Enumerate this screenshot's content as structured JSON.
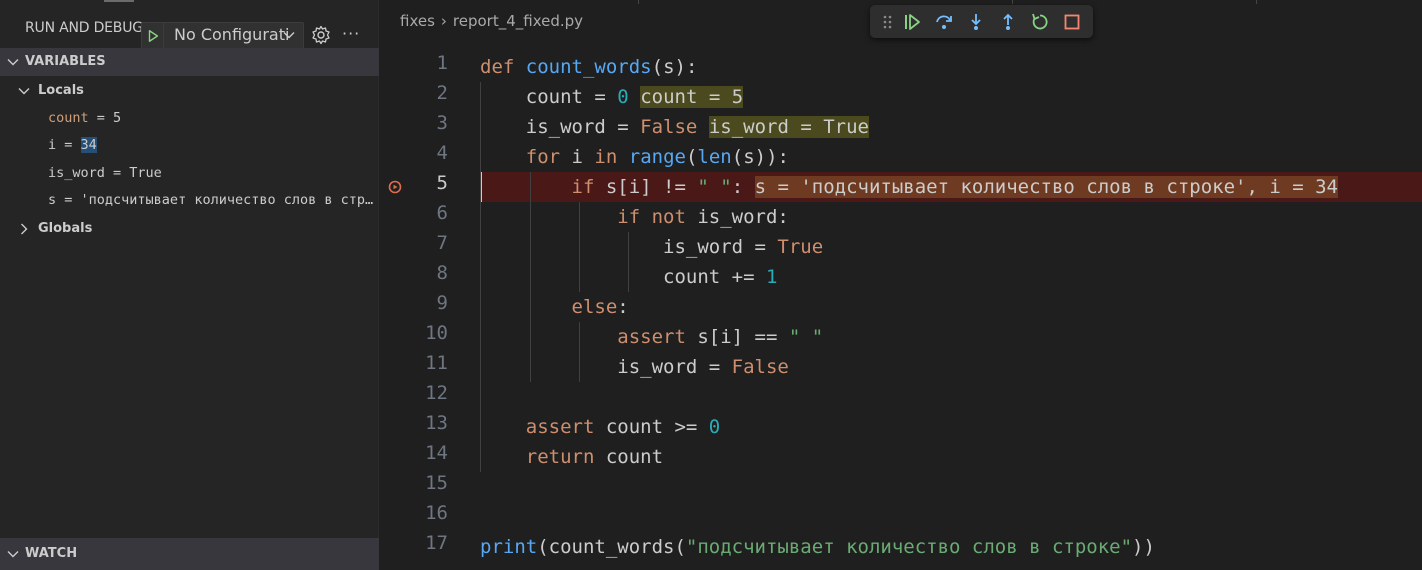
{
  "sidebar": {
    "run_title": "RUN AND DEBUG",
    "config_value": "No Configurati",
    "more_label": "···",
    "variables_label": "VARIABLES",
    "locals_label": "Locals",
    "globals_label": "Globals",
    "watch_label": "WATCH",
    "locals": [
      {
        "name": "count",
        "value": "5"
      },
      {
        "name": "i",
        "value": "34"
      },
      {
        "name": "is_word",
        "value": "True"
      },
      {
        "name": "s",
        "value": "'подсчитывает количество слов в строке'"
      }
    ]
  },
  "editor": {
    "breadcrumb": [
      "fixes",
      "report_4_fixed.py"
    ],
    "current_line": 5,
    "line_numbers": [
      "1",
      "2",
      "3",
      "4",
      "5",
      "6",
      "7",
      "8",
      "9",
      "10",
      "11",
      "12",
      "13",
      "14",
      "15",
      "16",
      "17"
    ],
    "inline_values": {
      "line2": "count = 5",
      "line3": "is_word = True",
      "line5": "s = 'подсчитывает количество слов в строке', i = 34"
    },
    "strings": {
      "print_arg": "\"подсчитывает количество слов в строке\""
    }
  },
  "colors": {
    "breakpoint": "#e06c4b",
    "current_line_bg": "#4b1818",
    "keyword": "#cf8e6d",
    "function": "#56a8f5",
    "number": "#2aacb8",
    "string": "#6aab73"
  },
  "icons": {
    "start": "play-icon",
    "settings": "gear-icon",
    "toolbar": [
      "drag-grip-icon",
      "continue-icon",
      "step-over-icon",
      "step-into-icon",
      "step-out-icon",
      "restart-icon",
      "stop-icon"
    ]
  }
}
